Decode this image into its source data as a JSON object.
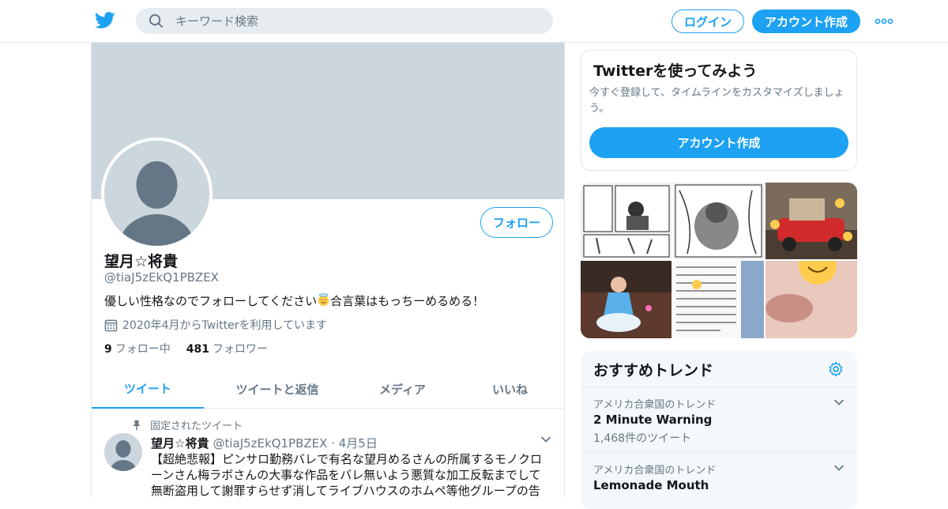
{
  "header": {
    "search_placeholder": "キーワード検索",
    "login_label": "ログイン",
    "signup_label": "アカウント作成"
  },
  "profile": {
    "name": "望月☆将貴",
    "handle": "@tiaJ5zEkQ1PBZEX",
    "bio_before": "優しい性格なのでフォローしてください",
    "bio_after": "合言葉はもっちーめるめる！",
    "joined": "2020年4月からTwitterを利用しています",
    "following_count": "9",
    "following_label": "フォロー中",
    "followers_count": "481",
    "followers_label": "フォロワー",
    "follow_button": "フォロー"
  },
  "tabs": [
    {
      "label": "ツイート",
      "active": true
    },
    {
      "label": "ツイートと返信",
      "active": false
    },
    {
      "label": "メディア",
      "active": false
    },
    {
      "label": "いいね",
      "active": false
    }
  ],
  "pinned_tweet": {
    "pinned_label": "固定されたツイート",
    "name": "望月☆将貴",
    "handle": "@tiaJ5zEkQ1PBZEX",
    "date": "4月5日",
    "text": "【超絶悲報】ピンサロ勤務バレで有名な望月めるさんの所属するモノクローンさん梅ラボさんの大事な作品をバレ無いよう悪質な加工反転までして無断盗用して謝罪すらせず消してライブハウスのホムペ等他グループの告"
  },
  "signup_card": {
    "title": "Twitterを使ってみよう",
    "description": "今すぐ登録して、タイムラインをカスタマイズしましょう。",
    "button": "アカウント作成"
  },
  "trends": {
    "title": "おすすめトレンド",
    "items": [
      {
        "context": "アメリカ合衆国のトレンド",
        "name": "2 Minute Warning",
        "count": "1,468件のツイート"
      },
      {
        "context": "アメリカ合衆国のトレンド",
        "name": "Lemonade Mouth",
        "count": ""
      }
    ]
  },
  "colors": {
    "accent": "#1da1f2",
    "banner": "#ccd6dd",
    "secondary_text": "#657786"
  },
  "icons": [
    "twitter-logo-icon",
    "search-icon",
    "more-icon",
    "calendar-icon",
    "pin-icon",
    "chevron-down-icon",
    "gear-icon"
  ]
}
